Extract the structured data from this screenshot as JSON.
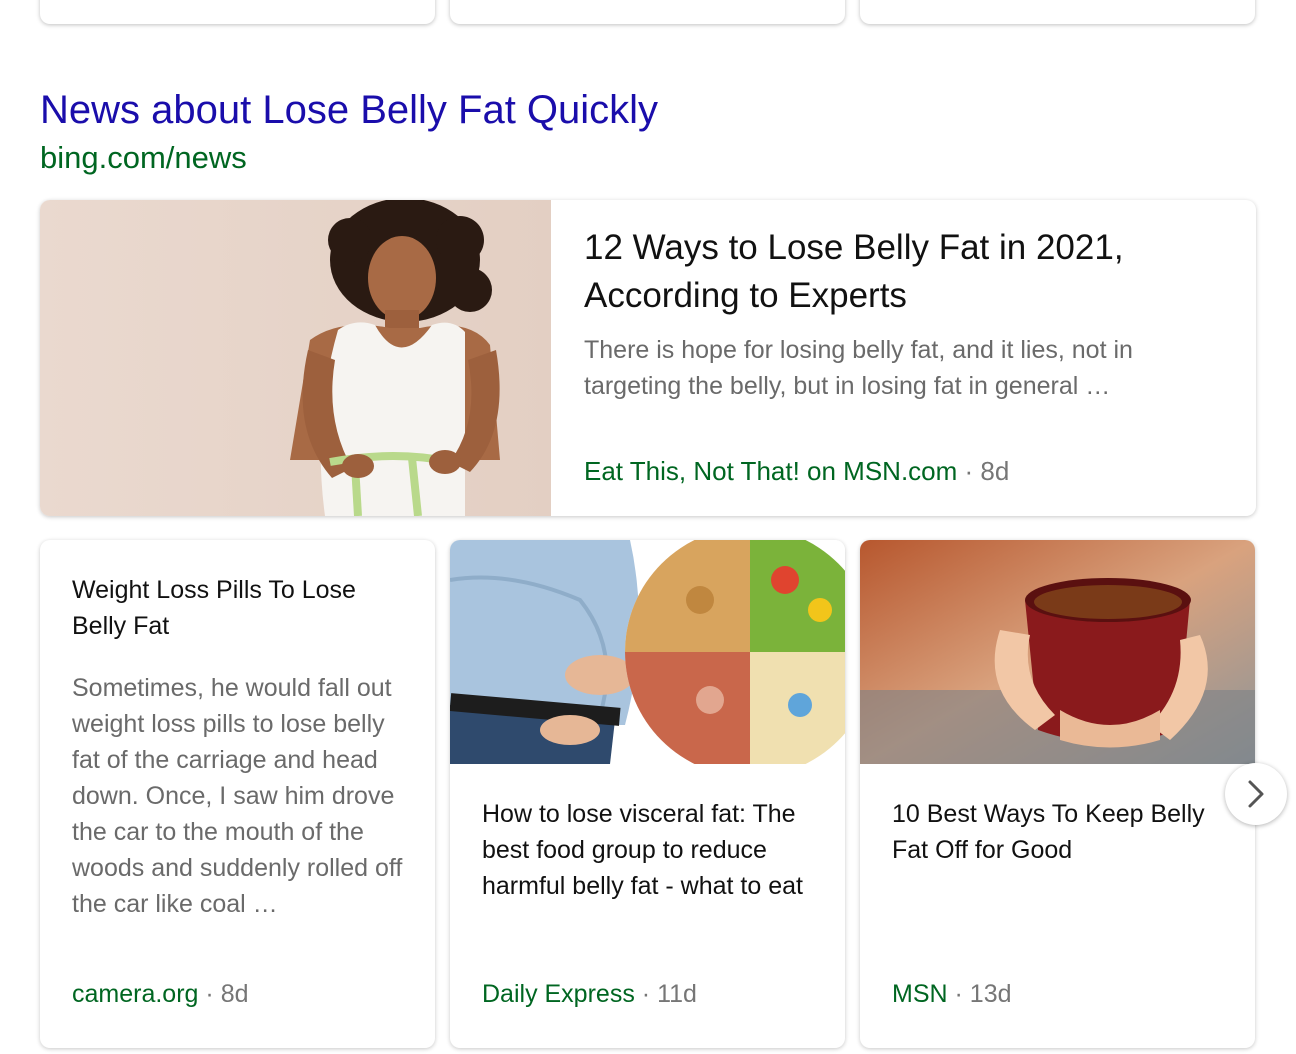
{
  "section": {
    "title": "News about Lose Belly Fat Quickly",
    "source": "bing.com/news"
  },
  "featured": {
    "title": "12 Ways to Lose Belly Fat in 2021, According to Experts",
    "snippet": "There is hope for losing belly fat, and it lies, not in targeting the belly, but in losing fat in general …",
    "source": "Eat This, Not That! on MSN.com",
    "separator": "·",
    "age": "8d",
    "image": "woman-measuring-waist-photo"
  },
  "cards": [
    {
      "title": "Weight Loss Pills To Lose Belly Fat",
      "snippet": "Sometimes, he would fall out weight loss pills to lose belly fat of the carriage and head down. Once, I saw him drove the car to the mouth of the woods and suddenly rolled off the car like coal …",
      "source": "camera.org",
      "separator": "·",
      "age": "8d"
    },
    {
      "title": "How to lose visceral fat: The best food group to reduce harmful belly fat - what to eat",
      "source": "Daily Express",
      "separator": "·",
      "age": "11d",
      "image": "belly-and-food-wheel-photo"
    },
    {
      "title": "10 Best Ways To Keep Belly Fat Off for Good",
      "source": "MSN",
      "separator": "·",
      "age": "13d",
      "image": "hands-holding-tea-cup-photo"
    }
  ],
  "carousel": {
    "next_icon": "chevron-right-icon"
  },
  "colors": {
    "title_link": "#1a0dab",
    "source_green": "#006621",
    "snippet_gray": "#6a6a6a"
  }
}
